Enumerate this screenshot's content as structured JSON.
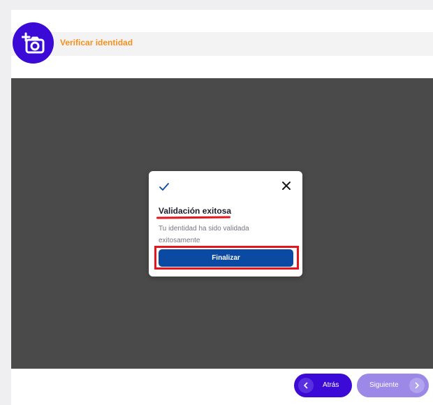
{
  "header": {
    "title": "Verificar identidad",
    "avatar_icon": "add-photo-camera-icon",
    "accent_color": "#f5901e",
    "avatar_color": "#3b0ad6"
  },
  "modal": {
    "status_icon": "check-icon",
    "close_icon": "close-icon",
    "title": "Validación exitosa",
    "description": "Tu identidad ha sido validada exitosamente",
    "finalize_label": "Finalizar",
    "button_color": "#0b4aa3",
    "highlight_color": "#e3161e"
  },
  "footer": {
    "back_label": "Atrás",
    "next_label": "Siguiente",
    "back_icon": "chevron-left-icon",
    "next_icon": "chevron-right-icon"
  }
}
